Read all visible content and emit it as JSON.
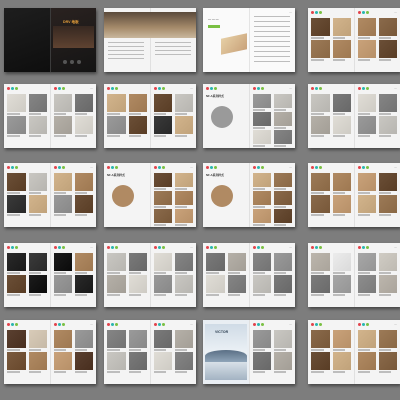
{
  "catalog": {
    "brand_text": "DRV 地板",
    "series_title": "NF-A系列样式",
    "cover_text": "VICTOR",
    "accent_colors": {
      "red": "#e2434b",
      "teal": "#29b6b0",
      "green": "#7ac043",
      "orange": "#e9a13b"
    },
    "background": "#7d7d7d",
    "spreads": [
      {
        "layout": "cover",
        "theme": "dark"
      },
      {
        "layout": "intro",
        "theme": "photo"
      },
      {
        "layout": "chinese-intro",
        "theme": "white"
      },
      {
        "layout": "grid",
        "theme": "wood"
      },
      {
        "layout": "grid",
        "theme": "stone"
      },
      {
        "layout": "grid",
        "theme": "mixed"
      },
      {
        "layout": "series",
        "theme": "stone"
      },
      {
        "layout": "grid",
        "theme": "stone"
      },
      {
        "layout": "grid",
        "theme": "mixed"
      },
      {
        "layout": "series",
        "theme": "wood"
      },
      {
        "layout": "series",
        "theme": "wood"
      },
      {
        "layout": "grid",
        "theme": "wood"
      },
      {
        "layout": "grid",
        "theme": "dark-interior"
      },
      {
        "layout": "grid",
        "theme": "stone"
      },
      {
        "layout": "grid",
        "theme": "stone"
      },
      {
        "layout": "grid",
        "theme": "stone-icons"
      },
      {
        "layout": "grid",
        "theme": "wood-mixed"
      },
      {
        "layout": "grid",
        "theme": "stone"
      },
      {
        "layout": "feature",
        "theme": "poster"
      },
      {
        "layout": "grid",
        "theme": "wood"
      }
    ]
  }
}
